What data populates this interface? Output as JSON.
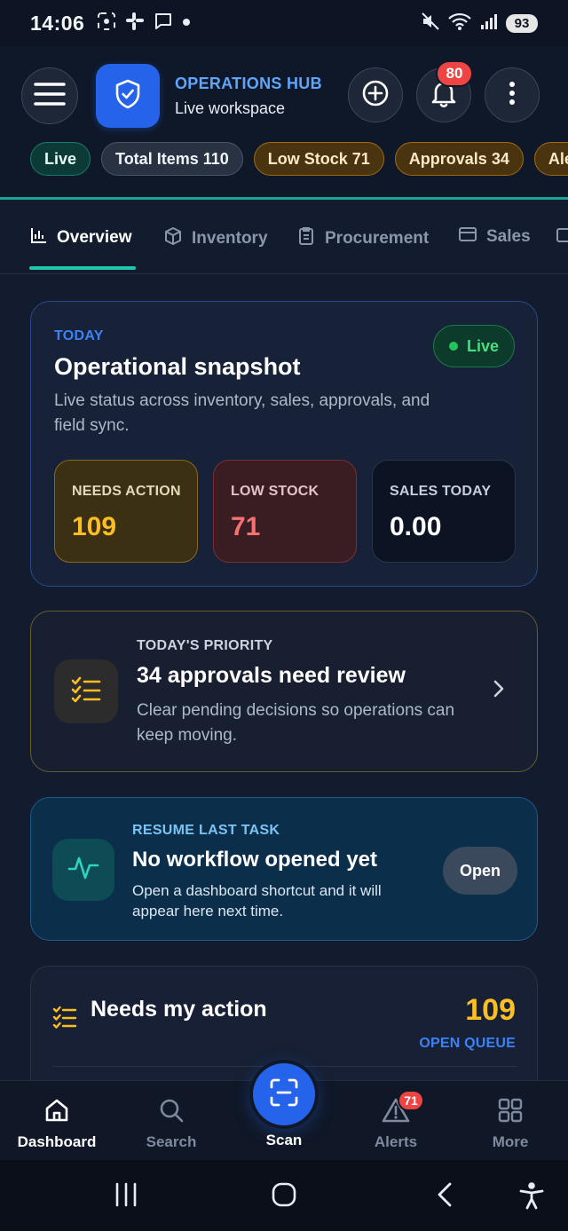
{
  "status_bar": {
    "time": "14:06",
    "battery": "93",
    "icons": [
      "screenshot-icon",
      "slack-icon",
      "message-icon",
      "dot-icon",
      "mute-icon",
      "wifi-icon",
      "signal-icon"
    ]
  },
  "header": {
    "menu_icon": "hamburger-menu-icon",
    "logo_icon": "shield-check-icon",
    "title": "OPERATIONS HUB",
    "subtitle": "Live workspace",
    "notification_count": "80",
    "actions": [
      "add-icon",
      "bell-icon",
      "more-vert-icon"
    ]
  },
  "chips": [
    {
      "label": "Live",
      "style": "live"
    },
    {
      "label": "Total Items 110",
      "style": "neutral"
    },
    {
      "label": "Low Stock 71",
      "style": "warn"
    },
    {
      "label": "Approvals 34",
      "style": "warn"
    },
    {
      "label": "Aler",
      "style": "warn"
    }
  ],
  "tabs": [
    {
      "label": "Overview",
      "icon": "bar-chart-icon",
      "active": true
    },
    {
      "label": "Inventory",
      "icon": "box-icon",
      "active": false
    },
    {
      "label": "Procurement",
      "icon": "clipboard-icon",
      "active": false
    },
    {
      "label": "Sales",
      "icon": "card-icon",
      "active": false
    }
  ],
  "snapshot": {
    "eyebrow": "TODAY",
    "title": "Operational snapshot",
    "description": "Live status across inventory, sales, approvals, and field sync.",
    "live_label": "Live",
    "stats": {
      "needs_action": {
        "label": "NEEDS ACTION",
        "value": "109"
      },
      "low_stock": {
        "label": "LOW STOCK",
        "value": "71"
      },
      "sales_today": {
        "label": "SALES TODAY",
        "value": "0.00"
      }
    }
  },
  "priority": {
    "eyebrow": "TODAY'S PRIORITY",
    "title": "34 approvals need review",
    "description": "Clear pending decisions so operations can keep moving."
  },
  "resume": {
    "eyebrow": "RESUME LAST TASK",
    "title": "No workflow opened yet",
    "description": "Open a dashboard shortcut and it will appear here next time.",
    "button": "Open"
  },
  "needs_action": {
    "title": "Needs my action",
    "count": "109",
    "link": "OPEN QUEUE"
  },
  "bottom_nav": {
    "dashboard": "Dashboard",
    "search": "Search",
    "scan": "Scan",
    "alerts": "Alerts",
    "alerts_badge": "71",
    "more": "More"
  },
  "colors": {
    "accent": "#2563eb",
    "teal": "#1ec8b0",
    "warning": "#fbbf24",
    "danger": "#f87171",
    "background": "#131c2e"
  }
}
